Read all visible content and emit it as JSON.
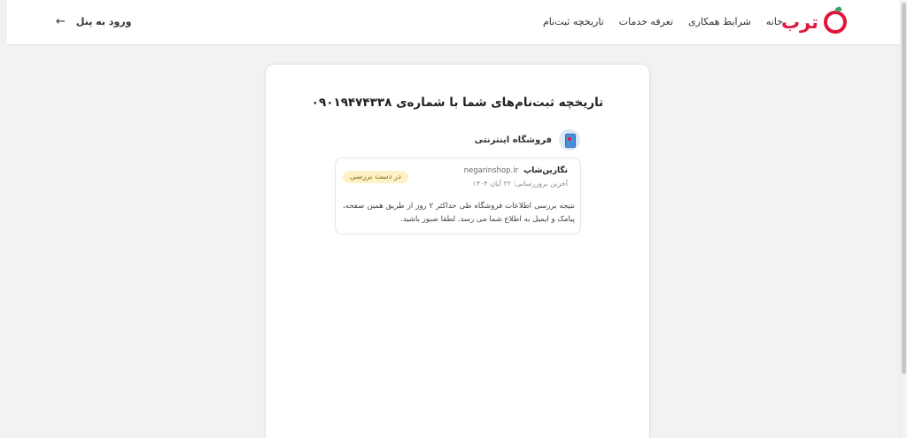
{
  "header": {
    "logo_text": "ترب",
    "nav": [
      {
        "label": "خانه"
      },
      {
        "label": "شرایط همکاری"
      },
      {
        "label": "تعرفه خدمات"
      },
      {
        "label": "تاریخچه ثبت‌نام"
      }
    ],
    "login_label": "ورود به پنل",
    "login_arrow": "←"
  },
  "main": {
    "title": "تاریخچه ثبت‌نام‌های شما با شماره‌ی ۰۹۰۱۹۴۷۴۳۳۸",
    "category_label": "فروشگاه اینترنتی",
    "registration": {
      "shop_name": "نگارین‌شاپ",
      "shop_domain": "negarinshop.ir",
      "last_update": "آخرین بروزرسانی: ۲۲ آبان ۱۴۰۴",
      "status": "در دست بررسی",
      "message": "نتیجه بررسی اطلاعات فروشگاه طی حداکثر ۲ روز از طریق همین صفحه، پیامک و ایمیل به اطلاع شما می رسد. لطفا صبور باشید."
    }
  },
  "colors": {
    "brand": "#e0173d",
    "badge_bg": "#fdf1c6",
    "badge_text": "#8a6a12"
  },
  "icons": {
    "logo": "torob-logo-icon",
    "back": "arrow-left-icon",
    "category": "online-store-icon"
  }
}
